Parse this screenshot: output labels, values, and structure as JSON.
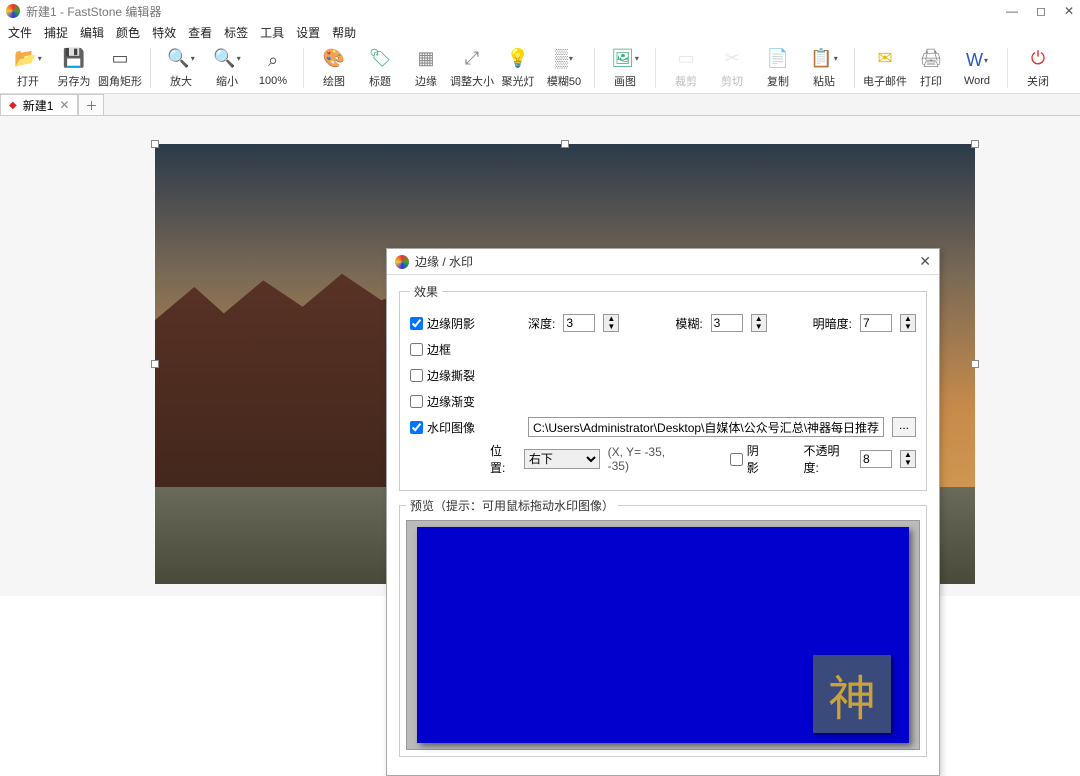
{
  "titlebar": {
    "title": "新建1 - FastStone 编辑器"
  },
  "menu": [
    "文件",
    "捕捉",
    "编辑",
    "颜色",
    "特效",
    "查看",
    "标签",
    "工具",
    "设置",
    "帮助"
  ],
  "toolbar": [
    {
      "name": "open",
      "label": "打开",
      "icon": "📂",
      "cls": "ic-open",
      "dd": true
    },
    {
      "name": "saveas",
      "label": "另存为",
      "icon": "💾",
      "cls": "ic-save"
    },
    {
      "name": "roundrect",
      "label": "圆角矩形",
      "icon": "▭",
      "cls": "ic-rect"
    },
    {
      "sep": true
    },
    {
      "name": "zoomin",
      "label": "放大",
      "icon": "🔍",
      "cls": "ic-zin",
      "dd": true
    },
    {
      "name": "zoomout",
      "label": "缩小",
      "icon": "🔍",
      "cls": "ic-zout",
      "dd": true
    },
    {
      "name": "zoom100",
      "label": "100%",
      "icon": "⌕",
      "cls": "ic-100"
    },
    {
      "sep": true
    },
    {
      "name": "draw",
      "label": "绘图",
      "icon": "🎨",
      "cls": "ic-draw"
    },
    {
      "name": "caption",
      "label": "标题",
      "icon": "🏷",
      "cls": "ic-cap"
    },
    {
      "name": "edge",
      "label": "边缘",
      "icon": "▦",
      "cls": "ic-edge"
    },
    {
      "name": "resize",
      "label": "调整大小",
      "icon": "⤢",
      "cls": "ic-resize"
    },
    {
      "name": "spotlight",
      "label": "聚光灯",
      "icon": "💡",
      "cls": "ic-spot"
    },
    {
      "name": "blur50",
      "label": "模糊50",
      "icon": "▒",
      "cls": "ic-blur",
      "dd": true
    },
    {
      "sep": true
    },
    {
      "name": "canvas",
      "label": "画图",
      "icon": "🖼",
      "cls": "ic-canvas",
      "dd": true
    },
    {
      "sep": true
    },
    {
      "name": "crop",
      "label": "裁剪",
      "icon": "▭",
      "cls": "ic-crop",
      "disabled": true
    },
    {
      "name": "cut",
      "label": "剪切",
      "icon": "✂",
      "cls": "ic-cut",
      "disabled": true
    },
    {
      "name": "copy",
      "label": "复制",
      "icon": "📄",
      "cls": "ic-copy"
    },
    {
      "name": "paste",
      "label": "粘贴",
      "icon": "📋",
      "cls": "ic-paste",
      "dd": true
    },
    {
      "sep": true
    },
    {
      "name": "email",
      "label": "电子邮件",
      "icon": "✉",
      "cls": "ic-mail"
    },
    {
      "name": "print",
      "label": "打印",
      "icon": "🖨",
      "cls": "ic-print"
    },
    {
      "name": "word",
      "label": "Word",
      "icon": "W",
      "cls": "ic-word",
      "dd": true
    },
    {
      "sep": true
    },
    {
      "name": "close",
      "label": "关闭",
      "icon": "⏻",
      "cls": "ic-close"
    }
  ],
  "tab": {
    "name": "新建1"
  },
  "dialog": {
    "title": "边缘 / 水印",
    "effects_legend": "效果",
    "edge_shadow": "边缘阴影",
    "depth_label": "深度:",
    "depth_value": "3",
    "blur_label": "模糊:",
    "blur_value": "3",
    "brightness_label": "明暗度:",
    "brightness_value": "7",
    "border": "边框",
    "edge_tear": "边缘撕裂",
    "edge_fade": "边缘渐变",
    "watermark_image": "水印图像",
    "watermark_path": "C:\\Users\\Administrator\\Desktop\\自媒体\\公众号汇总\\神器每日推荐\\神器小图",
    "browse": "...",
    "position_label": "位置:",
    "position_value": "右下",
    "coord": "(X, Y= -35, -35)",
    "shadow": "阴影",
    "opacity_label": "不透明度:",
    "opacity_value": "8",
    "preview_legend": "预览（提示：可用鼠标拖动水印图像）",
    "watermark_glyph": "神"
  }
}
